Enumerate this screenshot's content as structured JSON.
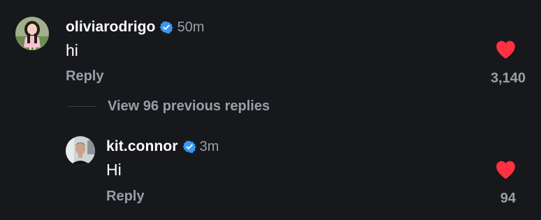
{
  "comments": [
    {
      "username": "oliviarodrigo",
      "verified": true,
      "timestamp": "50m",
      "text": "hi",
      "reply_label": "Reply",
      "like_count": "3,140",
      "liked": true,
      "avatar_icon": "avatar-oliviarodrigo"
    }
  ],
  "view_replies_label": "View 96 previous replies",
  "replies": [
    {
      "username": "kit.connor",
      "verified": true,
      "timestamp": "3m",
      "text": "Hi",
      "reply_label": "Reply",
      "like_count": "94",
      "liked": true,
      "avatar_icon": "avatar-kit-connor"
    }
  ],
  "colors": {
    "background": "#16181c",
    "text_primary": "#ffffff",
    "text_secondary": "#9b9ea6",
    "verified_blue": "#3897f0",
    "like_red": "#ff3040"
  }
}
